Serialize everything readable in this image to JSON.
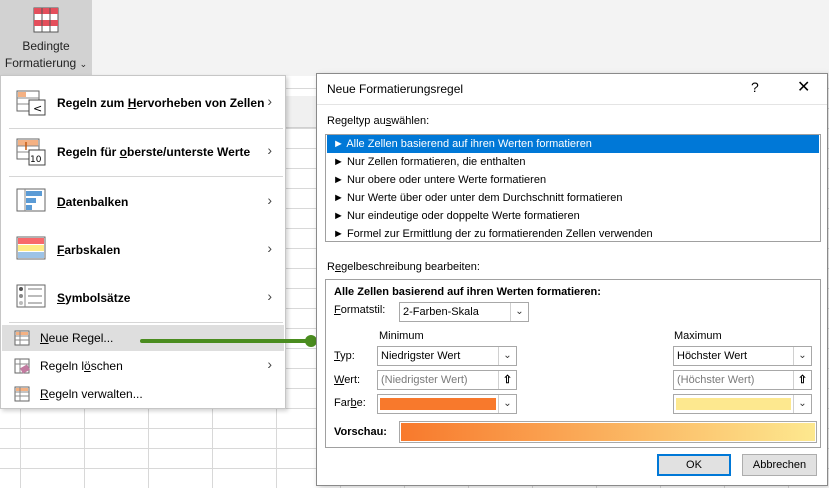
{
  "ribbon": {
    "button_line1": "Bedingte",
    "button_line2": "Formatierung",
    "chevron": "⌄",
    "icon": "conditional-formatting-icon"
  },
  "menu": {
    "items": [
      {
        "pre": "Regeln zum ",
        "ul": "H",
        "post": "ervorheben von Zellen",
        "icon": "highlight-rules-icon",
        "has_submenu": true
      },
      {
        "pre": "Regeln für ",
        "ul": "o",
        "post": "berste/unterste Werte",
        "icon": "top-bottom-rules-icon",
        "has_submenu": true
      },
      {
        "pre": "",
        "ul": "D",
        "post": "atenbalken",
        "icon": "data-bars-icon",
        "has_submenu": true
      },
      {
        "pre": "",
        "ul": "F",
        "post": "arbskalen",
        "icon": "color-scales-icon",
        "has_submenu": true
      },
      {
        "pre": "",
        "ul": "S",
        "post": "ymbolsätze",
        "icon": "icon-sets-icon",
        "has_submenu": true
      },
      {
        "pre": "",
        "ul": "N",
        "post": "eue Regel...",
        "icon": "new-rule-icon",
        "has_submenu": false
      },
      {
        "pre": "Regeln l",
        "ul": "ö",
        "post": "schen",
        "icon": "clear-rules-icon",
        "has_submenu": true
      },
      {
        "pre": "",
        "ul": "R",
        "post": "egeln verwalten...",
        "icon": "manage-rules-icon",
        "has_submenu": false
      }
    ],
    "submenu_arrow": "›"
  },
  "dialog": {
    "title": "Neue Formatierungsregel",
    "help": "?",
    "close": "✕",
    "ruletype_label_pre": "Regeltyp au",
    "ruletype_label_ul": "s",
    "ruletype_label_post": "wählen:",
    "rule_types": [
      "► Alle Zellen basierend auf ihren Werten formatieren",
      "► Nur Zellen formatieren, die enthalten",
      "► Nur obere oder untere Werte formatieren",
      "► Nur Werte über oder unter dem Durchschnitt formatieren",
      "► Nur eindeutige oder doppelte Werte formatieren",
      "► Formel zur Ermittlung der zu formatierenden Zellen verwenden"
    ],
    "selected_index": 0,
    "desc_label_pre": "R",
    "desc_label_ul": "e",
    "desc_label_post": "gelbeschreibung bearbeiten:",
    "desc_title": "Alle Zellen basierend auf ihren Werten formatieren:",
    "formatstil_label_ul": "F",
    "formatstil_label_post": "ormatstil:",
    "formatstil_value": "2-Farben-Skala",
    "minimum_header": "Minimum",
    "maximum_header": "Maximum",
    "typ_label_ul": "T",
    "typ_label_post": "yp:",
    "wert_label_ul": "W",
    "wert_label_post": "ert:",
    "farbe_label_pre": "Far",
    "farbe_label_ul": "b",
    "farbe_label_post": "e:",
    "min_type": "Niedrigster Wert",
    "max_type": "Höchster Wert",
    "min_value_placeholder": "(Niedrigster Wert)",
    "max_value_placeholder": "(Höchster Wert)",
    "ref_picker": "⇧",
    "dropdown_glyph": "⌄",
    "vorschau_label": "Vorschau:",
    "min_color": "#f8792c",
    "max_color": "#fde88f",
    "ok_label": "OK",
    "cancel_label": "Abbrechen"
  }
}
